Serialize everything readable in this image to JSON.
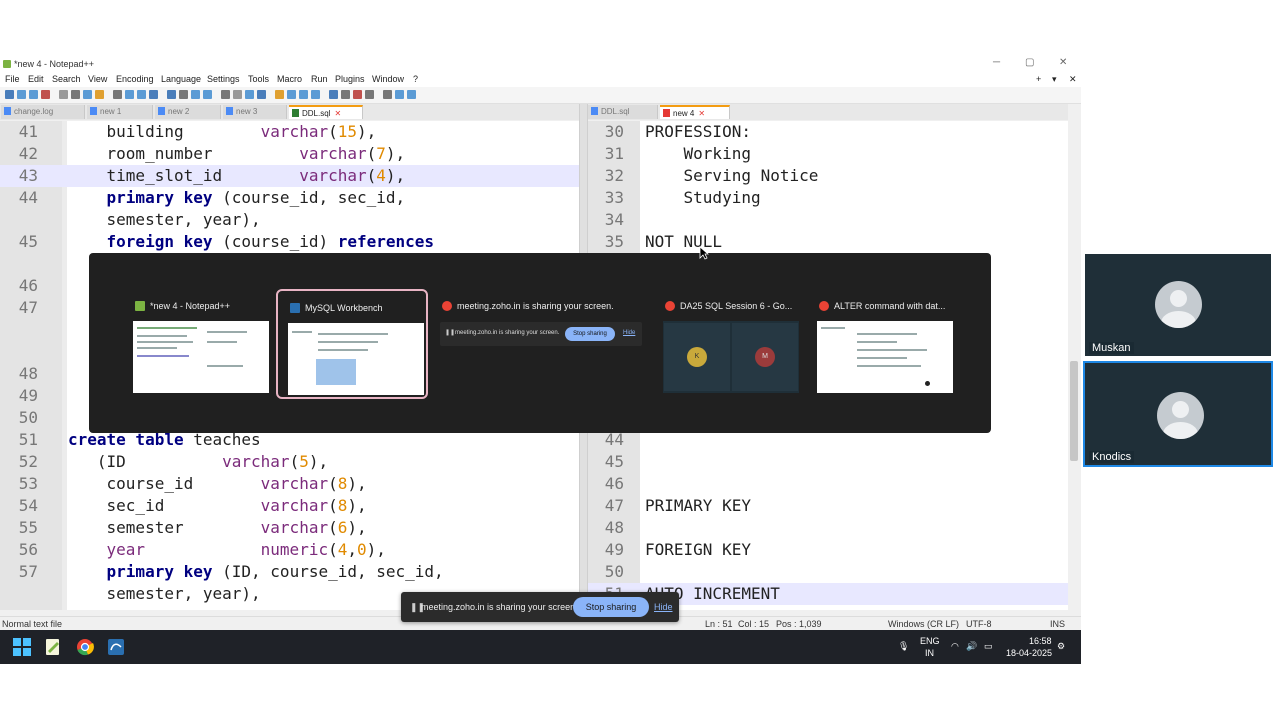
{
  "window": {
    "title": "*new 4 - Notepad++"
  },
  "menu": [
    "File",
    "Edit",
    "Search",
    "View",
    "Encoding",
    "Language",
    "Settings",
    "Tools",
    "Macro",
    "Run",
    "Plugins",
    "Window",
    "?"
  ],
  "left_tabs": [
    {
      "label": "change.log",
      "active": false
    },
    {
      "label": "new 1",
      "active": false
    },
    {
      "label": "new 2",
      "active": false
    },
    {
      "label": "new 3",
      "active": false
    },
    {
      "label": "DDL.sql",
      "active": true
    }
  ],
  "right_tabs": [
    {
      "label": "DDL.sql",
      "active": false
    },
    {
      "label": "new 4",
      "active": true
    }
  ],
  "left_editor": [
    {
      "n": "41",
      "tokens": [
        {
          "t": "    building        "
        },
        {
          "t": "varchar",
          "c": "ty"
        },
        {
          "t": "("
        },
        {
          "t": "15",
          "c": "num"
        },
        {
          "t": "),"
        }
      ]
    },
    {
      "n": "42",
      "tokens": [
        {
          "t": "    room_number         "
        },
        {
          "t": "varchar",
          "c": "ty"
        },
        {
          "t": "("
        },
        {
          "t": "7",
          "c": "num"
        },
        {
          "t": "),"
        }
      ]
    },
    {
      "n": "43",
      "hl": true,
      "tokens": [
        {
          "t": "    time_slot_id        "
        },
        {
          "t": "varchar",
          "c": "ty"
        },
        {
          "t": "("
        },
        {
          "t": "4",
          "c": "num"
        },
        {
          "t": "),"
        }
      ]
    },
    {
      "n": "44",
      "tokens": [
        {
          "t": "    "
        },
        {
          "t": "primary key",
          "c": "kw"
        },
        {
          "t": " (course_id, sec_id,"
        }
      ]
    },
    {
      "n": "",
      "tokens": [
        {
          "t": "    semester, year),"
        }
      ]
    },
    {
      "n": "45",
      "tokens": [
        {
          "t": "    "
        },
        {
          "t": "foreign key",
          "c": "kw"
        },
        {
          "t": " (course_id) "
        },
        {
          "t": "references",
          "c": "kw"
        }
      ]
    },
    {
      "n": "",
      "tokens": []
    },
    {
      "n": "46",
      "tokens": []
    },
    {
      "n": "47",
      "tokens": []
    },
    {
      "n": "",
      "tokens": []
    },
    {
      "n": "",
      "tokens": []
    },
    {
      "n": "48",
      "tokens": []
    },
    {
      "n": "49",
      "tokens": []
    },
    {
      "n": "50",
      "tokens": []
    },
    {
      "n": "51",
      "tokens": [
        {
          "t": "create table",
          "c": "kw"
        },
        {
          "t": " teaches"
        }
      ]
    },
    {
      "n": "52",
      "tokens": [
        {
          "t": "   (ID          "
        },
        {
          "t": "varchar",
          "c": "ty"
        },
        {
          "t": "("
        },
        {
          "t": "5",
          "c": "num"
        },
        {
          "t": "),"
        }
      ]
    },
    {
      "n": "53",
      "tokens": [
        {
          "t": "    course_id       "
        },
        {
          "t": "varchar",
          "c": "ty"
        },
        {
          "t": "("
        },
        {
          "t": "8",
          "c": "num"
        },
        {
          "t": "),"
        }
      ]
    },
    {
      "n": "54",
      "tokens": [
        {
          "t": "    sec_id          "
        },
        {
          "t": "varchar",
          "c": "ty"
        },
        {
          "t": "("
        },
        {
          "t": "8",
          "c": "num"
        },
        {
          "t": "),"
        }
      ]
    },
    {
      "n": "55",
      "tokens": [
        {
          "t": "    semester        "
        },
        {
          "t": "varchar",
          "c": "ty"
        },
        {
          "t": "("
        },
        {
          "t": "6",
          "c": "num"
        },
        {
          "t": "),"
        }
      ]
    },
    {
      "n": "56",
      "tokens": [
        {
          "t": "    "
        },
        {
          "t": "year",
          "c": "ty"
        },
        {
          "t": "            "
        },
        {
          "t": "numeric",
          "c": "ty"
        },
        {
          "t": "("
        },
        {
          "t": "4",
          "c": "num"
        },
        {
          "t": ","
        },
        {
          "t": "0",
          "c": "num"
        },
        {
          "t": "),"
        }
      ]
    },
    {
      "n": "57",
      "tokens": [
        {
          "t": "    "
        },
        {
          "t": "primary key",
          "c": "kw"
        },
        {
          "t": " (ID, course_id, sec_id,"
        }
      ]
    },
    {
      "n": "",
      "tokens": [
        {
          "t": "    semester, year),"
        }
      ]
    }
  ],
  "right_editor": [
    {
      "n": "30",
      "tokens": [
        {
          "t": "PROFESSION:"
        }
      ]
    },
    {
      "n": "31",
      "tokens": [
        {
          "t": "    Working"
        }
      ]
    },
    {
      "n": "32",
      "tokens": [
        {
          "t": "    Serving Notice"
        }
      ]
    },
    {
      "n": "33",
      "tokens": [
        {
          "t": "    Studying"
        }
      ]
    },
    {
      "n": "34",
      "tokens": []
    },
    {
      "n": "35",
      "tokens": [
        {
          "t": "NOT NULL"
        }
      ]
    },
    {
      "n": "",
      "tokens": []
    },
    {
      "n": "",
      "tokens": []
    },
    {
      "n": "",
      "tokens": []
    },
    {
      "n": "",
      "tokens": []
    },
    {
      "n": "",
      "tokens": []
    },
    {
      "n": "",
      "tokens": []
    },
    {
      "n": "",
      "tokens": []
    },
    {
      "n": "",
      "tokens": []
    },
    {
      "n": "44",
      "tokens": []
    },
    {
      "n": "45",
      "tokens": []
    },
    {
      "n": "46",
      "tokens": []
    },
    {
      "n": "47",
      "tokens": [
        {
          "t": "PRIMARY KEY"
        }
      ]
    },
    {
      "n": "48",
      "tokens": []
    },
    {
      "n": "49",
      "tokens": [
        {
          "t": "FOREIGN KEY"
        }
      ]
    },
    {
      "n": "50",
      "tokens": []
    },
    {
      "n": "51",
      "hl": true,
      "tokens": [
        {
          "t": "AUTO INCREMENT"
        }
      ]
    }
  ],
  "statusbar": {
    "file_type": "Normal text file",
    "ln": "Ln : 51",
    "col": "Col : 15",
    "pos": "Pos : 1,039",
    "eol": "Windows (CR LF)",
    "encoding": "UTF-8",
    "mode": "INS"
  },
  "switcher": {
    "windows": [
      {
        "title": "*new 4 - Notepad++",
        "icon": "notepadpp-icon",
        "icon_color": "#7cb342",
        "selected": false
      },
      {
        "title": "MySQL Workbench",
        "icon": "mysql-workbench-icon",
        "icon_color": "#2a6fb0",
        "selected": true
      },
      {
        "title": "meeting.zoho.in is sharing your screen.",
        "icon": "chrome-icon",
        "icon_color": "#ea4335",
        "selected": false,
        "mini_text": "meeting.zoho.in is sharing your screen.",
        "mini_stop": "Stop sharing",
        "mini_hide": "Hide"
      },
      {
        "title": "DA25 SQL Session 6 - Go...",
        "icon": "chrome-icon",
        "icon_color": "#ea4335",
        "selected": false,
        "avatars": [
          "K",
          "M"
        ]
      },
      {
        "title": "ALTER command with dat...",
        "icon": "chrome-icon",
        "icon_color": "#ea4335",
        "selected": false
      }
    ]
  },
  "sharebar": {
    "text": "meeting.zoho.in is sharing your screen.",
    "stop": "Stop sharing",
    "hide": "Hide"
  },
  "participants": [
    {
      "name": "Muskan",
      "active": false
    },
    {
      "name": "Knodics",
      "active": true
    }
  ],
  "taskbar": {
    "lang": "ENG",
    "region": "IN",
    "time": "16:58",
    "date": "18-04-2025",
    "apps": [
      "windows-start-icon",
      "notepadpp-icon",
      "chrome-icon",
      "mysql-workbench-icon"
    ]
  }
}
